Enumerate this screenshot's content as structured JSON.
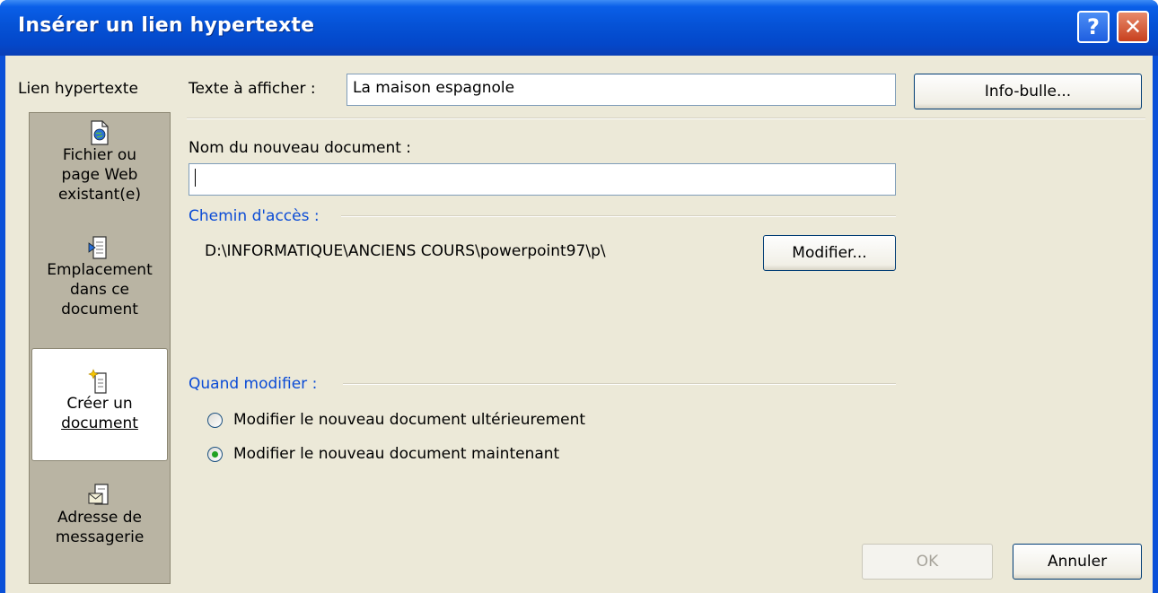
{
  "window": {
    "title": "Insérer un lien hypertexte",
    "help_glyph": "?",
    "close_glyph": "✕"
  },
  "sidebar": {
    "heading": "Lien hypertexte",
    "items": [
      {
        "lines": [
          "Fichier ou",
          "page Web",
          "existant(e)"
        ],
        "icon": "file-web-icon",
        "selected": false
      },
      {
        "lines": [
          "Emplacement",
          "dans ce",
          "document"
        ],
        "icon": "document-place-icon",
        "selected": false
      },
      {
        "lines": [
          "Créer un",
          "document"
        ],
        "icon": "new-document-icon",
        "selected": true
      },
      {
        "lines": [
          "Adresse de",
          "messagerie"
        ],
        "icon": "email-icon",
        "selected": false
      }
    ]
  },
  "form": {
    "display_text_label": "Texte à afficher :",
    "display_text_value": "La maison espagnole",
    "tooltip_button": "Info-bulle...",
    "new_doc_label": "Nom du nouveau document :",
    "new_doc_value": "",
    "path_label": "Chemin d'accès :",
    "path_value": "D:\\INFORMATIQUE\\ANCIENS COURS\\powerpoint97\\p\\",
    "modify_button": "Modifier...",
    "when_label": "Quand modifier :",
    "radio_later": "Modifier le nouveau document ultérieurement",
    "radio_now": "Modifier le nouveau document maintenant",
    "selected_option": "now"
  },
  "footer": {
    "ok": "OK",
    "cancel": "Annuler"
  },
  "colors": {
    "title_bar": "#0552d6",
    "dialog_bg": "#ece9d8",
    "section_label": "#0a4bd6",
    "radio_dot": "#21a121"
  }
}
